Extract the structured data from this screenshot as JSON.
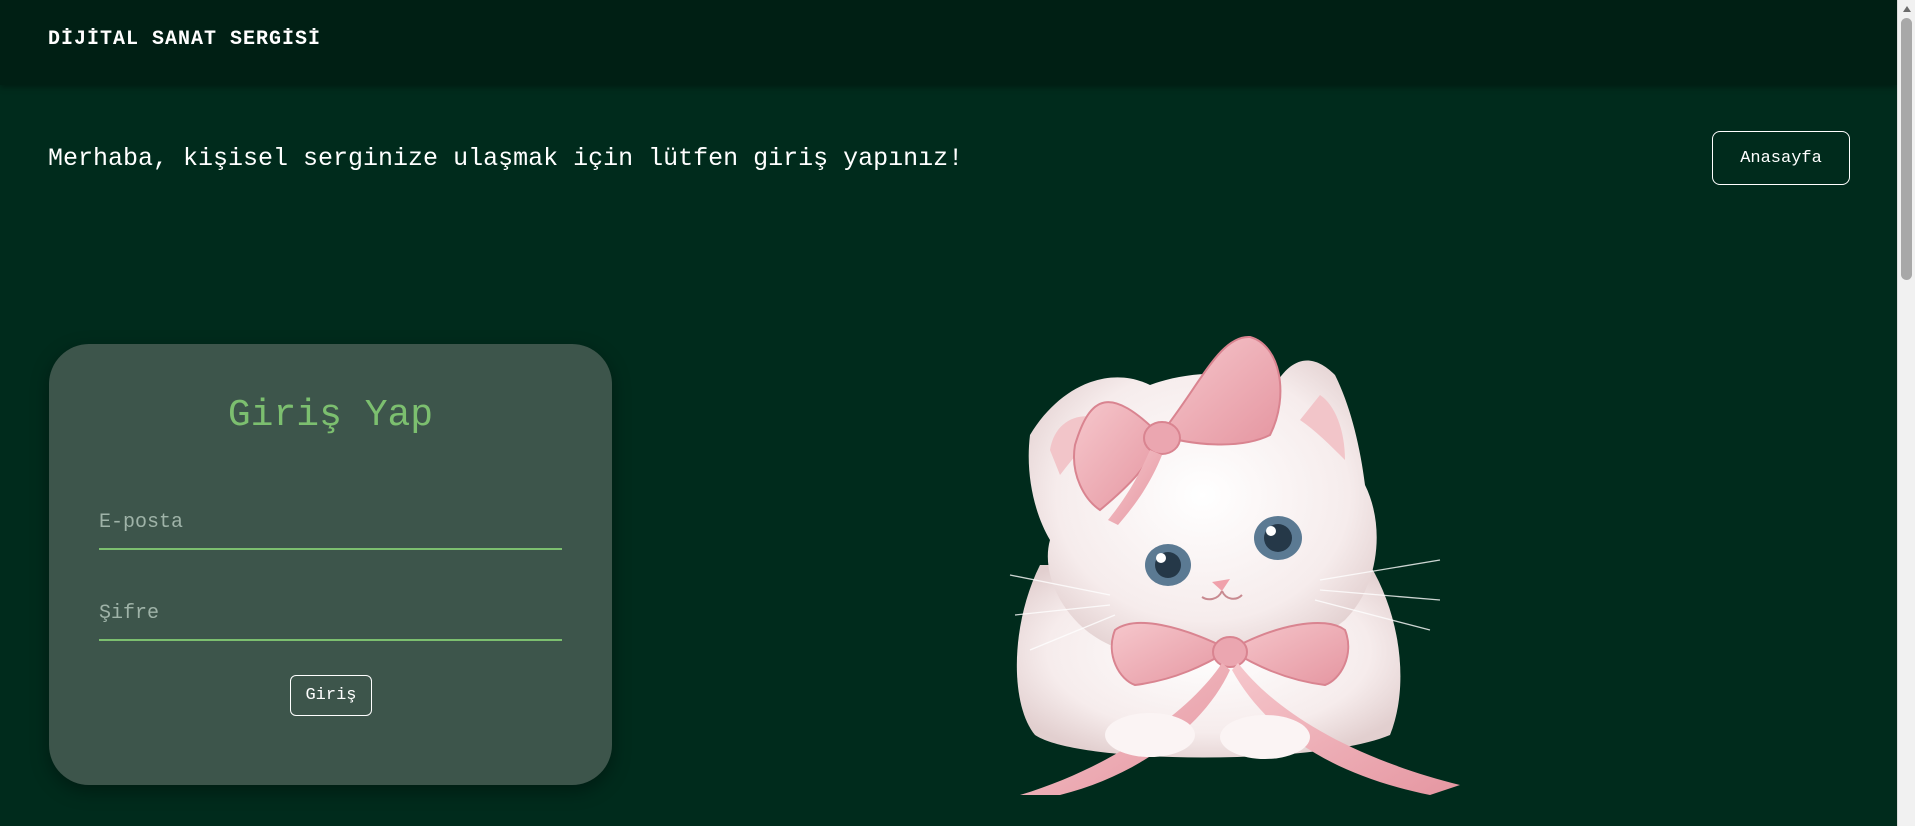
{
  "header": {
    "brand": "DİJİTAL SANAT SERGİSİ"
  },
  "intro": {
    "message": "Merhaba, kişisel serginize ulaşmak için lütfen giriş yapınız!",
    "home_label": "Anasayfa"
  },
  "login": {
    "title": "Giriş Yap",
    "email_placeholder": "E-posta",
    "password_placeholder": "Şifre",
    "submit_label": "Giriş"
  },
  "illustration": {
    "icon": "cat-with-pink-bows-illustration"
  },
  "colors": {
    "background": "#002b1c",
    "topbar": "#001f14",
    "card": "#3d554b",
    "accent": "#7cbf6f"
  }
}
